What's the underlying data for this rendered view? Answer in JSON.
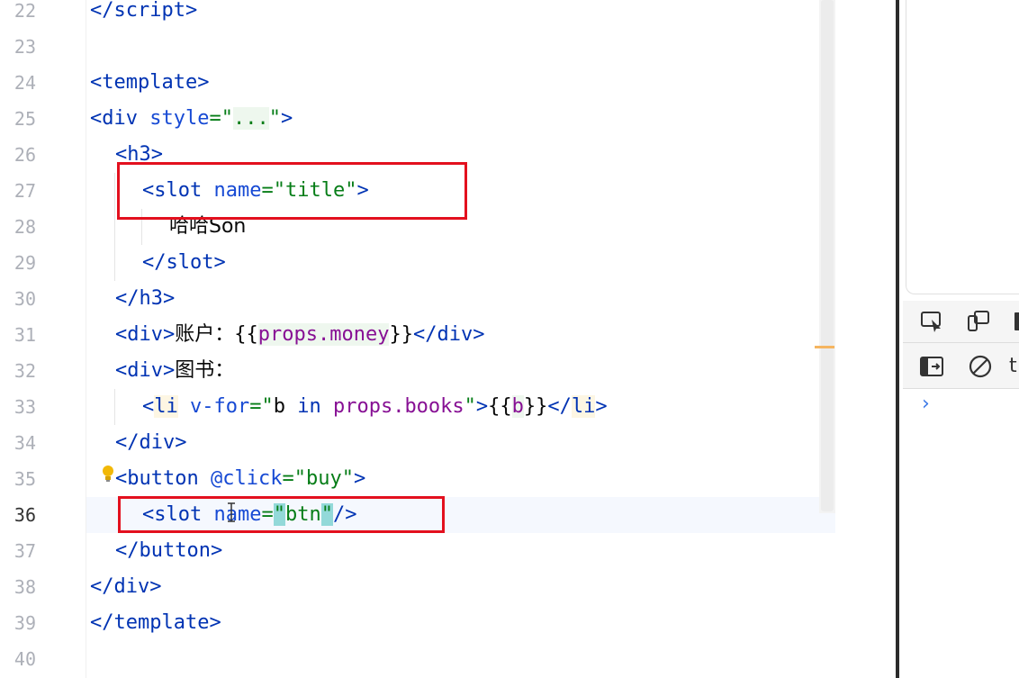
{
  "editor": {
    "current_line": "36",
    "line_numbers": [
      "22",
      "23",
      "24",
      "25",
      "26",
      "27",
      "28",
      "29",
      "30",
      "31",
      "32",
      "33",
      "34",
      "35",
      "36",
      "37",
      "38",
      "39",
      "40"
    ],
    "code": {
      "l22": {
        "open": "</",
        "tag": "script",
        "close": ">"
      },
      "l24": {
        "open": "<",
        "tag": "template",
        "close": ">"
      },
      "l25": {
        "open": "<",
        "tag": "div",
        "attr": "style",
        "eq": "=",
        "q1": "\"",
        "val": "...",
        "q2": "\"",
        "close": ">"
      },
      "l26": {
        "open": "<",
        "tag": "h3",
        "close": ">"
      },
      "l27": {
        "open": "<",
        "tag": "slot",
        "attr": "name",
        "eq": "=",
        "str": "\"title\"",
        "close": ">"
      },
      "l28": {
        "text": "哈哈Son"
      },
      "l29": {
        "open": "</",
        "tag": "slot",
        "close": ">"
      },
      "l30": {
        "open": "</",
        "tag": "h3",
        "close": ">"
      },
      "l31": {
        "open": "<",
        "tag": "div",
        "close": ">",
        "text": "账户：",
        "mus_open": "{{",
        "expr": "props.money",
        "mus_close": "}}",
        "end_open": "</",
        "end_tag": "div",
        "end_close": ">"
      },
      "l32": {
        "open": "<",
        "tag": "div",
        "close": ">",
        "text": "图书："
      },
      "l33": {
        "open": "<",
        "tag": "li",
        "attr": "v-for",
        "eq": "=",
        "q1": "\"",
        "b": "b",
        "in": " in ",
        "expr": "props.books",
        "q2": "\"",
        "close": ">",
        "mus_open": "{{",
        "bvar": "b",
        "mus_close": "}}",
        "end_open": "</",
        "end_tag": "li",
        "end_close": ">"
      },
      "l34": {
        "open": "</",
        "tag": "div",
        "close": ">"
      },
      "l35": {
        "open": "<",
        "tag": "button",
        "attr": "@click",
        "eq": "=",
        "str": "\"buy\"",
        "close": ">"
      },
      "l36": {
        "open": "<",
        "tag": "slot",
        "attr": "name",
        "eq": "=",
        "q1": "\"",
        "val": "btn",
        "q2": "\"",
        "close": "/>"
      },
      "l37": {
        "open": "</",
        "tag": "button",
        "close": ">"
      },
      "l38": {
        "open": "</",
        "tag": "div",
        "close": ">"
      },
      "l39": {
        "open": "</",
        "tag": "template",
        "close": ">"
      }
    }
  },
  "devtools": {
    "filter_text": "t",
    "icons": [
      "inspect-element-icon",
      "device-toolbar-icon",
      "sidebar-toggle-icon",
      "clear-console-icon",
      "console-prompt-chevron-icon"
    ],
    "prompt": "›"
  },
  "colors": {
    "highlight_box": "#e3101e",
    "tag": "#0033b3",
    "string": "#067d17"
  }
}
